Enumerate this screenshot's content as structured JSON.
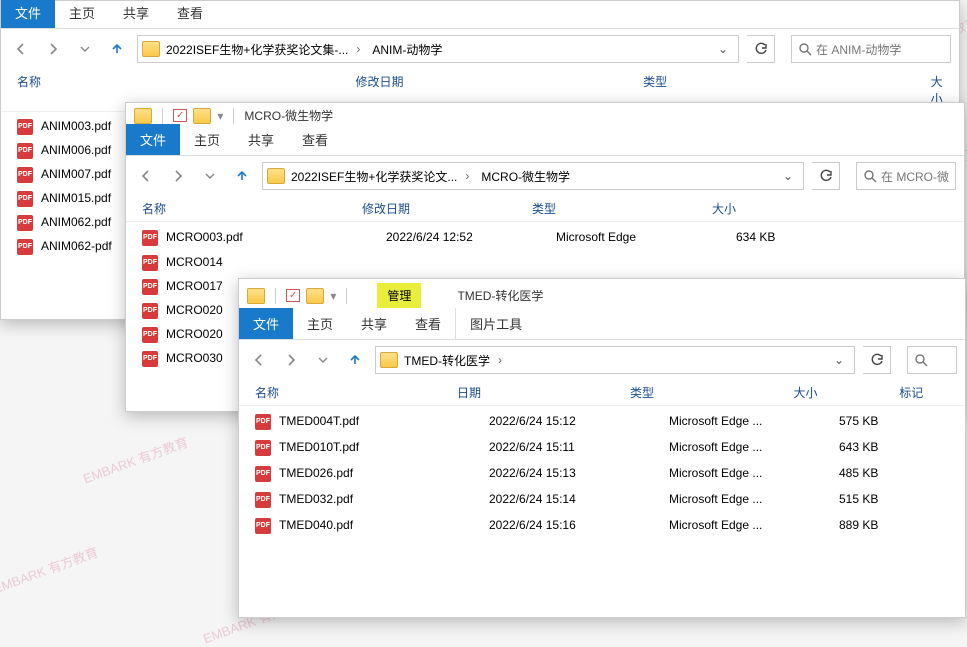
{
  "watermark_text": "EMBARK 有方教育",
  "win1": {
    "tabs": {
      "file": "文件",
      "home": "主页",
      "share": "共享",
      "view": "查看"
    },
    "nav_up_title": "上一级",
    "breadcrumb": {
      "seg1": "2022ISEF生物+化学获奖论文集-...",
      "seg2": "ANIM-动物学"
    },
    "search_placeholder": "在 ANIM-动物学",
    "headers": {
      "name": "名称",
      "date": "修改日期",
      "type": "类型",
      "size": "大小"
    },
    "files": [
      {
        "name": "ANIM003.pdf"
      },
      {
        "name": "ANIM006.pdf"
      },
      {
        "name": "ANIM007.pdf"
      },
      {
        "name": "ANIM015.pdf"
      },
      {
        "name": "ANIM062.pdf"
      },
      {
        "name": "ANIM062-pdf"
      }
    ]
  },
  "win2": {
    "title_path": "MCRO-微生物学",
    "tabs": {
      "file": "文件",
      "home": "主页",
      "share": "共享",
      "view": "查看"
    },
    "breadcrumb": {
      "seg1": "2022ISEF生物+化学获奖论文...",
      "seg2": "MCRO-微生物学"
    },
    "search_placeholder": "在 MCRO-微",
    "headers": {
      "name": "名称",
      "date": "修改日期",
      "type": "类型",
      "size": "大小"
    },
    "first_row": {
      "name": "MCRO003.pdf",
      "date": "2022/6/24 12:52",
      "type": "Microsoft Edge",
      "size": "634 KB"
    },
    "files": [
      {
        "name": "MCRO014"
      },
      {
        "name": "MCRO017"
      },
      {
        "name": "MCRO020"
      },
      {
        "name": "MCRO020"
      },
      {
        "name": "MCRO030"
      }
    ]
  },
  "win3": {
    "title_path": "TMED-转化医学",
    "manage_label": "管理",
    "tabs": {
      "file": "文件",
      "home": "主页",
      "share": "共享",
      "view": "查看",
      "picture": "图片工具"
    },
    "breadcrumb": {
      "seg1": "TMED-转化医学"
    },
    "headers": {
      "name": "名称",
      "date": "日期",
      "type": "类型",
      "size": "大小",
      "tag": "标记"
    },
    "files": [
      {
        "name": "TMED004T.pdf",
        "date": "2022/6/24 15:12",
        "type": "Microsoft Edge ...",
        "size": "575 KB"
      },
      {
        "name": "TMED010T.pdf",
        "date": "2022/6/24 15:11",
        "type": "Microsoft Edge ...",
        "size": "643 KB"
      },
      {
        "name": "TMED026.pdf",
        "date": "2022/6/24 15:13",
        "type": "Microsoft Edge ...",
        "size": "485 KB"
      },
      {
        "name": "TMED032.pdf",
        "date": "2022/6/24 15:14",
        "type": "Microsoft Edge ...",
        "size": "515 KB"
      },
      {
        "name": "TMED040.pdf",
        "date": "2022/6/24 15:16",
        "type": "Microsoft Edge ...",
        "size": "889 KB"
      }
    ]
  }
}
